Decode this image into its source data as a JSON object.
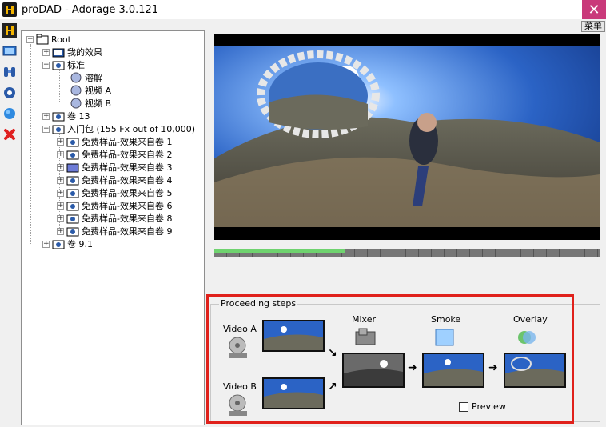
{
  "window": {
    "title": "proDAD - Adorage 3.0.121",
    "close_symbol": "✕",
    "menu_label": "菜单"
  },
  "toolbar": {
    "tools": [
      "adorage-logo-icon",
      "monitor-icon",
      "binoculars-icon",
      "settings-icon",
      "globe-icon",
      "delete-icon"
    ]
  },
  "tree": {
    "root": "Root",
    "items": [
      {
        "label": "我的效果"
      },
      {
        "label": "标准"
      },
      {
        "label": "溶解"
      },
      {
        "label": "视频 A"
      },
      {
        "label": "视频 B"
      },
      {
        "label": "卷 13"
      },
      {
        "label": "入门包 (155 Fx out of 10,000)"
      },
      {
        "label": "免费样品-效果来自卷 1"
      },
      {
        "label": "免费样品-效果来自卷 2"
      },
      {
        "label": "免费样品-效果来自卷 3"
      },
      {
        "label": "免费样品-效果来自卷 4"
      },
      {
        "label": "免费样品-效果来自卷 5"
      },
      {
        "label": "免费样品-效果来自卷 6"
      },
      {
        "label": "免费样品-效果来自卷 8"
      },
      {
        "label": "免费样品-效果来自卷 9"
      },
      {
        "label": "卷 9.1"
      }
    ]
  },
  "player": {
    "progress": 0.34
  },
  "steps": {
    "title": "Proceeding steps",
    "video_a": "Video A",
    "video_b": "Video B",
    "mixer": "Mixer",
    "smoke": "Smoke",
    "overlay": "Overlay",
    "preview_label": "Preview",
    "preview_checked": false,
    "arrow_right": "➜",
    "arrow_down_right": "↘",
    "arrow_up_right": "↗"
  }
}
